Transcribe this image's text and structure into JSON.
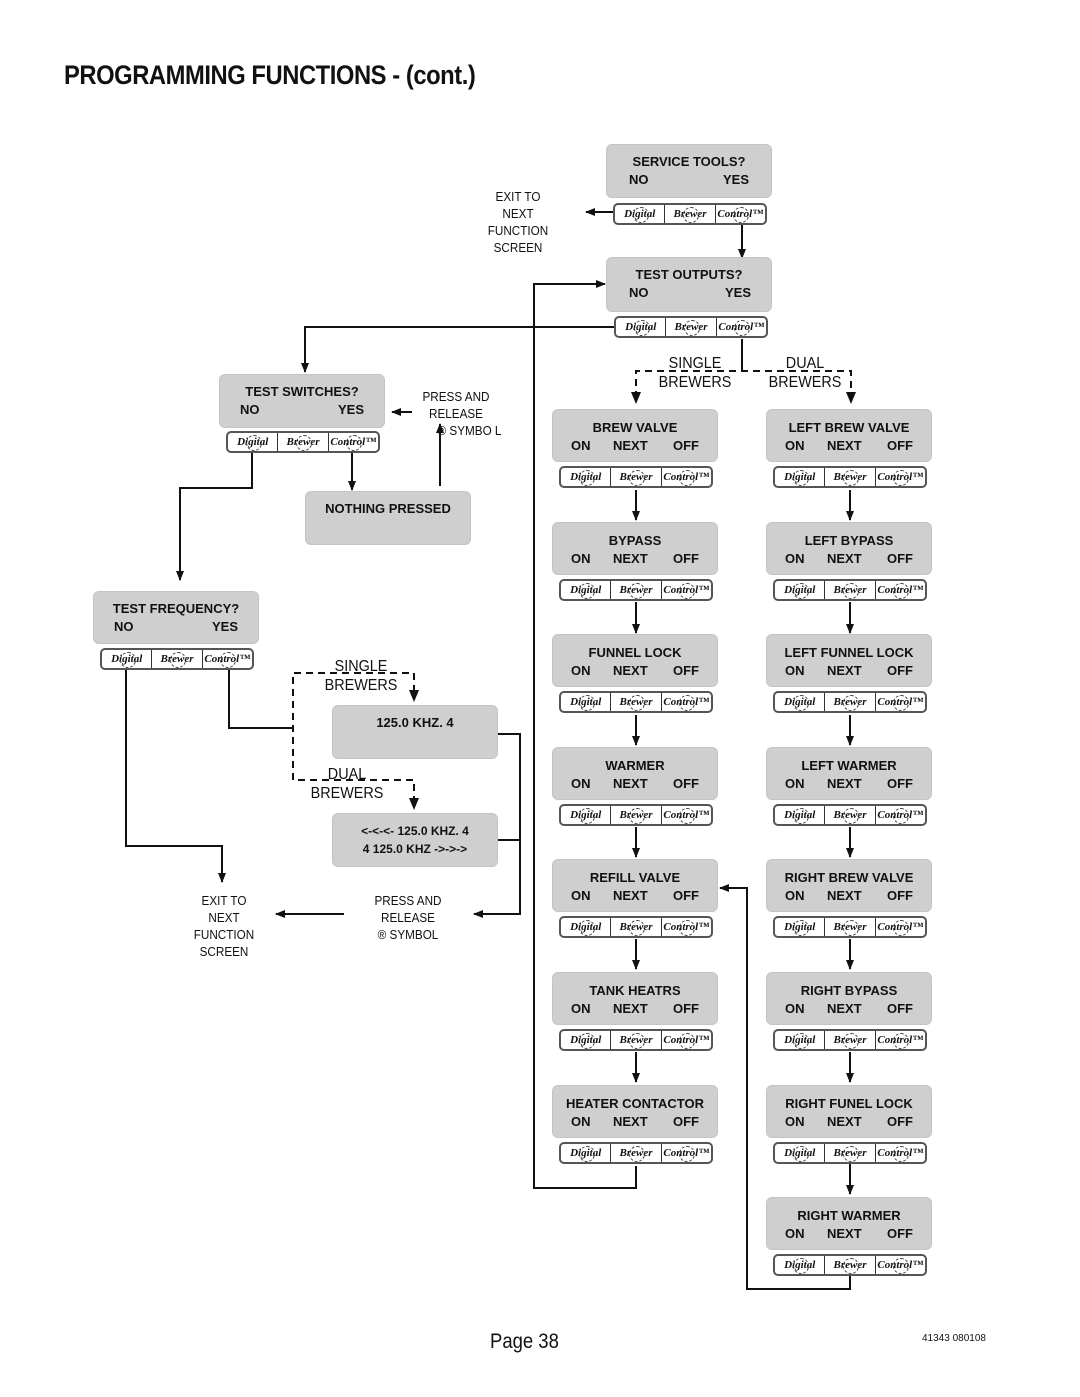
{
  "page": {
    "title": "PROGRAMMING FUNCTIONS - (cont.)",
    "page_number": "Page 38",
    "doc_code": "41343 080108"
  },
  "keypad": {
    "k1": "Digital",
    "k2": "Brewer",
    "k3": "Control™"
  },
  "screens": {
    "service_tools": {
      "line1": "SERVICE TOOLS?",
      "left": "NO",
      "right": "YES"
    },
    "test_outputs": {
      "line1": "TEST OUTPUTS?",
      "left": "NO",
      "right": "YES"
    },
    "test_switches": {
      "line1": "TEST SWITCHES?",
      "left": "NO",
      "right": "YES"
    },
    "nothing_pressed": {
      "line1": "NOTHING PRESSED"
    },
    "test_frequency": {
      "line1": "TEST FREQUENCY?",
      "left": "NO",
      "right": "YES"
    },
    "freq_single": {
      "line1": "125.0 KHZ.  4"
    },
    "freq_dual": {
      "line1": "<-<-<- 125.0 KHZ.  4",
      "line2": "4  125.0 KHZ ->->->"
    }
  },
  "options": {
    "on": "ON",
    "next": "NEXT",
    "off": "OFF"
  },
  "single_outputs": [
    "BREW VALVE",
    "BYPASS",
    "FUNNEL LOCK",
    "WARMER",
    "REFILL VALVE",
    "TANK HEATRS",
    "HEATER CONTACTOR"
  ],
  "dual_outputs": [
    "LEFT BREW VALVE",
    "LEFT BYPASS",
    "LEFT FUNNEL LOCK",
    "LEFT WARMER",
    "RIGHT BREW VALVE",
    "RIGHT BYPASS",
    "RIGHT FUNEL LOCK",
    "RIGHT WARMER"
  ],
  "labels": {
    "exit_top": [
      "EXIT TO",
      "NEXT FUNCTION",
      "SCREEN"
    ],
    "exit_bottom": [
      "EXIT TO",
      "NEXT FUNCTION",
      "SCREEN"
    ],
    "press_release_top": [
      "PRESS AND RELEASE",
      "® SYMBO L"
    ],
    "press_release_bottom": [
      "PRESS AND RELEASE",
      "® SYMBOL"
    ],
    "single_brewers_top": [
      "SINGLE",
      "BREWERS"
    ],
    "dual_brewers_top": [
      "DUAL",
      "BREWERS"
    ],
    "single_brewers_freq": [
      "SINGLE",
      "BREWERS"
    ],
    "dual_brewers_freq": [
      "DUAL",
      "BREWERS"
    ]
  }
}
